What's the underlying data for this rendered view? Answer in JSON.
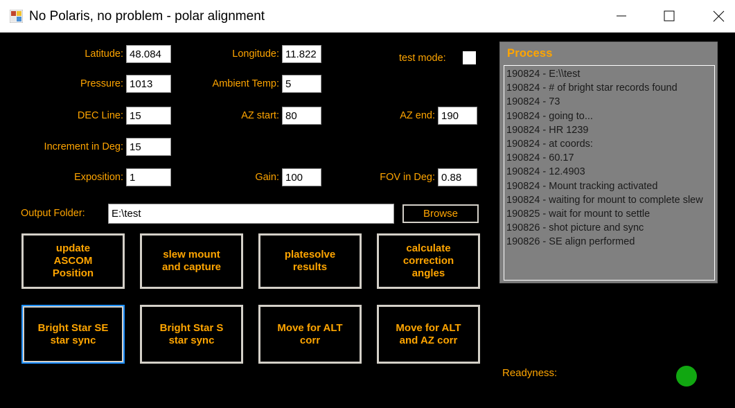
{
  "window": {
    "title": "No Polaris, no problem - polar alignment",
    "icon": "app-icon",
    "controls": {
      "minimize": "minimize-icon",
      "maximize": "maximize-icon",
      "close": "close-icon"
    }
  },
  "form": {
    "fields": [
      {
        "label": "Latitude:",
        "value": "48.084",
        "name": "latitude"
      },
      {
        "label": "Longitude:",
        "value": "11.822",
        "name": "longitude"
      },
      {
        "label": "Pressure:",
        "value": "1013",
        "name": "pressure"
      },
      {
        "label": "Ambient Temp:",
        "value": "5",
        "name": "ambient-temp"
      },
      {
        "label": "DEC Line:",
        "value": "15",
        "name": "dec-line"
      },
      {
        "label": "AZ start:",
        "value": "80",
        "name": "az-start"
      },
      {
        "label": "AZ end:",
        "value": "190",
        "name": "az-end"
      },
      {
        "label": "Increment in Deg:",
        "value": "15",
        "name": "increment-in-deg"
      },
      {
        "label": "Exposition:",
        "value": "1",
        "name": "exposition"
      },
      {
        "label": "Gain:",
        "value": "100",
        "name": "gain"
      },
      {
        "label": "FOV in Deg:",
        "value": "0.88",
        "name": "fov-in-deg"
      }
    ],
    "test_mode": {
      "label": "test mode:",
      "checked": false
    },
    "output_folder": {
      "label": "Output Folder:",
      "value": "E:\\test"
    },
    "browse_label": "Browse"
  },
  "actions": {
    "row1": [
      "update\nASCOM\nPosition",
      "slew mount\nand capture",
      "platesolve\nresults",
      "calculate\ncorrection\nangles"
    ],
    "row2": [
      "Bright Star SE\nstar sync",
      "Bright Star S\nstar sync",
      "Move for ALT\ncorr",
      "Move for ALT\nand AZ corr"
    ]
  },
  "process": {
    "title": "Process",
    "lines": [
      "190824 - E:\\\\test",
      "190824 - # of bright star records found",
      "190824 - 73",
      "190824 - going to...",
      "190824 - HR 1239",
      "190824 - at coords:",
      "190824 - 60.17",
      "190824 - 12.4903",
      "190824 - Mount tracking activated",
      "190824 - waiting for mount to complete slew",
      "190825 - wait for mount to settle",
      "190826 - shot picture and sync",
      "190826 - SE align performed"
    ]
  },
  "status": {
    "readyness_label": "Readyness:",
    "readyness_color": "#11a711"
  },
  "colors": {
    "background": "#000000",
    "label_orange": "#ffa500",
    "panel_gray": "#808080",
    "button_border": "#d4d0c8",
    "focus_blue": "#1e90ff"
  }
}
